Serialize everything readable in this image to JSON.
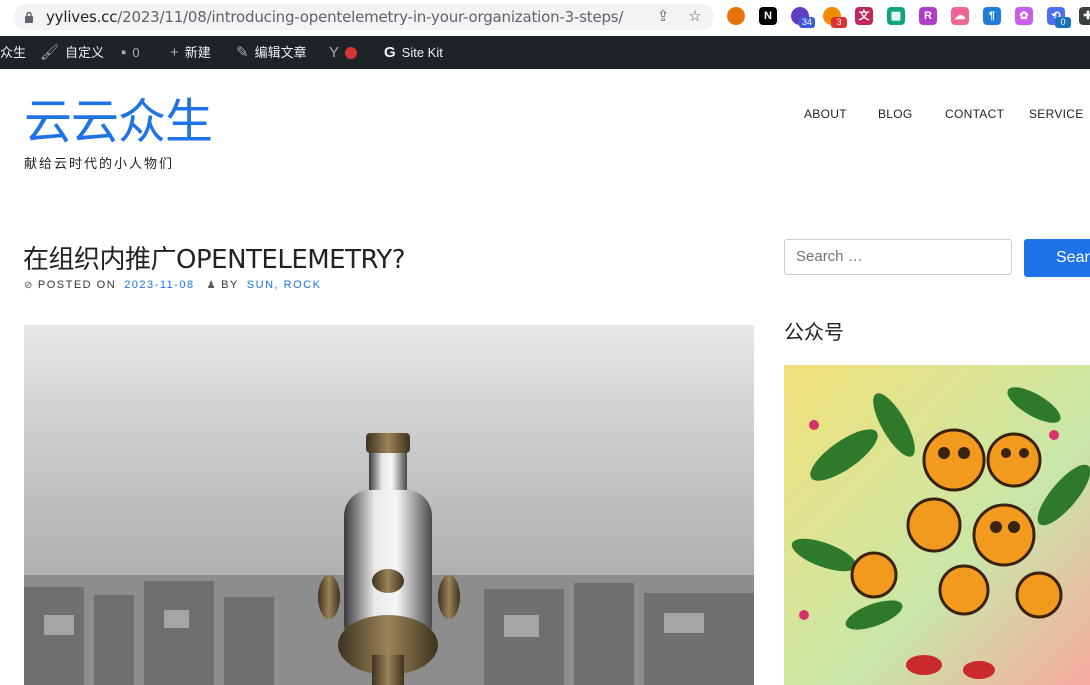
{
  "browser": {
    "url_host": "yylives.cc",
    "url_path": "/2023/11/08/introducing-opentelemetry-in-your-organization-3-steps/",
    "extensions": [
      {
        "name": "circle-ext-icon",
        "color": "#e8710a"
      },
      {
        "name": "notion-ext-icon",
        "color": "#000000",
        "glyph": "N"
      },
      {
        "name": "grad-ext-icon",
        "color": "#5f3dc4",
        "badge": "34",
        "badge_color": "#3b5bdb"
      },
      {
        "name": "orange-ext-icon",
        "color": "#f08c00",
        "badge": "3",
        "badge_color": "#e03131"
      },
      {
        "name": "translate-ext-icon",
        "color": "#c2255c",
        "glyph": "文"
      },
      {
        "name": "teal-ext-icon",
        "color": "#0ca678",
        "glyph": "▦"
      },
      {
        "name": "purple-ext-icon",
        "color": "#ae3ec9",
        "glyph": "R"
      },
      {
        "name": "cloud-ext-icon",
        "color": "#f06595",
        "glyph": "☁"
      },
      {
        "name": "blue-ext-icon",
        "color": "#1c7ed6",
        "glyph": "¶"
      },
      {
        "name": "openai-ext-icon",
        "color": "#cc5de8",
        "glyph": "✿"
      },
      {
        "name": "sync-ext-icon",
        "color": "#4c6ef5",
        "glyph": "⟲",
        "badge": "0",
        "badge_color": "#1971c2"
      },
      {
        "name": "puzzle-ext-icon",
        "color": "#3c4043",
        "glyph": "✚"
      }
    ]
  },
  "adminbar": {
    "site_label": "众生",
    "customize_label": "自定义",
    "comments_count": "0",
    "new_label": "新建",
    "edit_label": "编辑文章",
    "sitekit_label": "Site Kit"
  },
  "site": {
    "title": "云云众生",
    "tagline": "献给云时代的小人物们"
  },
  "nav": {
    "items": [
      "ABOUT",
      "BLOG",
      "CONTACT",
      "SERVICE"
    ]
  },
  "post": {
    "title": "在组织内推广OPENTELEMETRY?",
    "posted_on_label": "POSTED ON",
    "date": "2023-11-08",
    "by_label": "BY",
    "author": "SUN, ROCK"
  },
  "sidebar": {
    "search_placeholder": "Search …",
    "search_button": "Search",
    "widget_title": "公众号"
  },
  "colors": {
    "accent": "#1e73e8",
    "adminbar_bg": "#1d2327"
  }
}
